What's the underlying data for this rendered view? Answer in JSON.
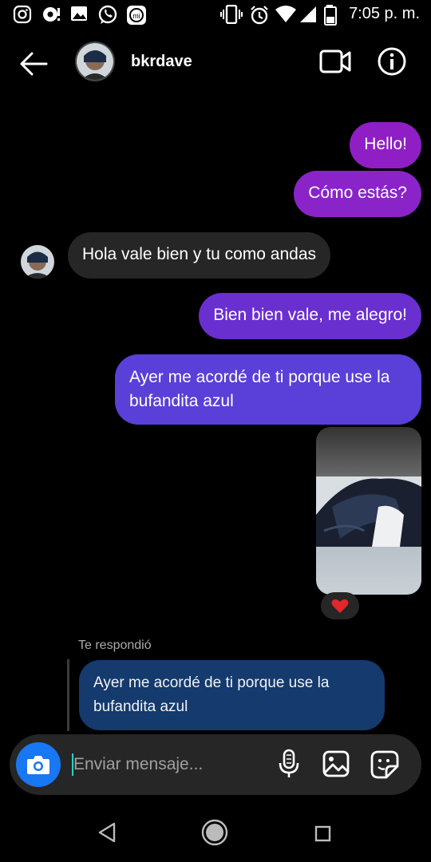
{
  "status_bar": {
    "time": "7:05 p. m.",
    "icons": [
      "instagram-icon",
      "chat-notification-icon",
      "image-icon",
      "whatsapp-icon",
      "mi-icon",
      "vibrate-icon",
      "alarm-icon",
      "wifi-icon",
      "signal-icon",
      "battery-icon"
    ]
  },
  "header": {
    "username": "bkrdave",
    "icons": [
      "back-arrow-icon",
      "video-call-icon",
      "info-icon"
    ]
  },
  "messages": [
    {
      "from": "me",
      "text": "Hello!"
    },
    {
      "from": "me",
      "text": "Cómo estás?"
    },
    {
      "from": "them",
      "text": "Hola vale bien y tu como andas"
    },
    {
      "from": "me",
      "text": "Bien bien vale, me alegro!"
    },
    {
      "from": "me",
      "text": "Ayer me acordé de ti porque use la bufandita azul"
    },
    {
      "from": "me",
      "type": "photo",
      "reaction": "heart"
    }
  ],
  "reply": {
    "label": "Te respondió",
    "quoted_text": "Ayer me acordé de ti porque use la bufandita azul"
  },
  "composer": {
    "placeholder": "Enviar mensaje...",
    "icons": [
      "camera-icon",
      "microphone-icon",
      "gallery-icon",
      "sticker-icon"
    ]
  },
  "colors": {
    "accent_blue": "#1877f2",
    "heart": "#e0282c",
    "purple": "#8f1fc4"
  },
  "nav_bar": {
    "icons": [
      "nav-back-icon",
      "nav-home-icon",
      "nav-recent-icon"
    ]
  }
}
